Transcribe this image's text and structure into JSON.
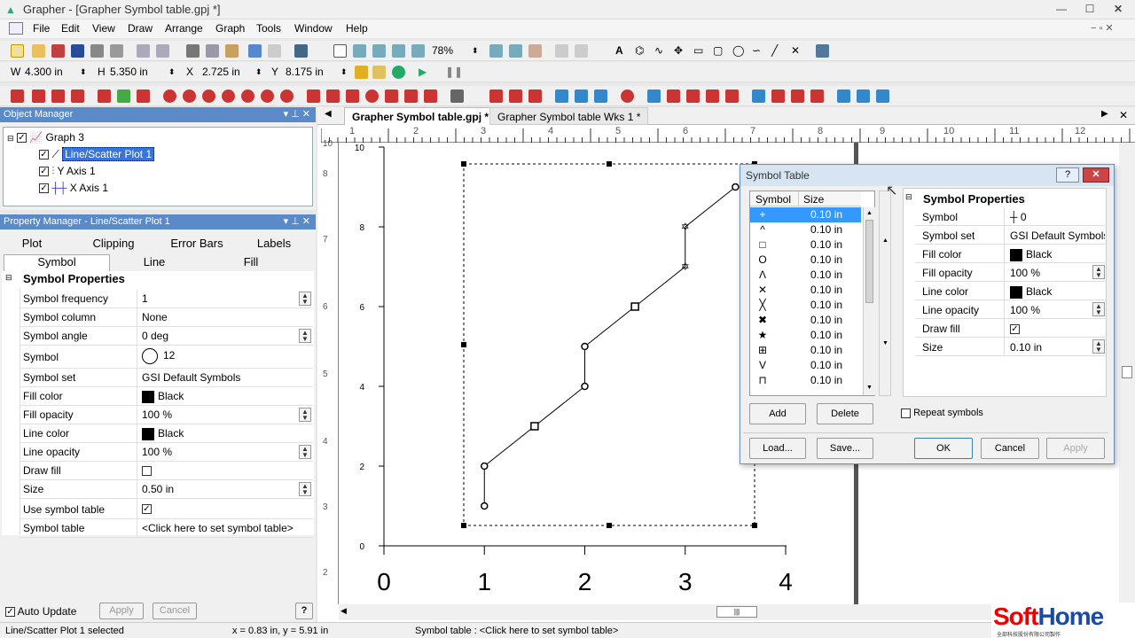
{
  "app": {
    "window_title": "Grapher - [Grapher Symbol table.gpj *]"
  },
  "menu": [
    "File",
    "Edit",
    "View",
    "Draw",
    "Arrange",
    "Graph",
    "Tools",
    "Window",
    "Help"
  ],
  "toolbar": {
    "zoom": "78%",
    "w_label": "W",
    "w_value": "4.300 in",
    "h_label": "H",
    "h_value": "5.350 in",
    "x_label": "X",
    "x_value": "2.725 in",
    "y_label": "Y",
    "y_value": "8.175 in"
  },
  "object_manager": {
    "title": "Object Manager",
    "items": [
      "Graph 3",
      "Line/Scatter Plot 1",
      "Y Axis 1",
      "X Axis 1"
    ]
  },
  "property_manager": {
    "title": "Property Manager - Line/Scatter Plot 1",
    "tabs_row1": [
      "Plot",
      "Clipping",
      "Error Bars",
      "Labels"
    ],
    "tabs_row2": [
      "Symbol",
      "Line",
      "Fill"
    ],
    "section": "Symbol Properties",
    "rows": [
      {
        "k": "Symbol frequency",
        "v": "1"
      },
      {
        "k": "Symbol column",
        "v": "None"
      },
      {
        "k": "Symbol angle",
        "v": "0 deg"
      },
      {
        "k": "Symbol",
        "v": "12"
      },
      {
        "k": "Symbol set",
        "v": "GSI Default Symbols"
      },
      {
        "k": "Fill color",
        "v": "Black"
      },
      {
        "k": "Fill opacity",
        "v": "100 %"
      },
      {
        "k": "Line color",
        "v": "Black"
      },
      {
        "k": "Line opacity",
        "v": "100 %"
      },
      {
        "k": "Draw fill",
        "v": ""
      },
      {
        "k": "Size",
        "v": "0.50 in"
      },
      {
        "k": "Use symbol table",
        "v": ""
      },
      {
        "k": "Symbol table",
        "v": "<Click here to set symbol table>"
      }
    ],
    "auto_update": "Auto Update",
    "apply": "Apply",
    "cancel": "Cancel",
    "help": "?"
  },
  "doc_tabs": [
    "Grapher Symbol table.gpj *",
    "Grapher Symbol table Wks 1 *"
  ],
  "ruler": {
    "top": [
      "1",
      "2",
      "3",
      "4",
      "5",
      "6",
      "7",
      "8",
      "9",
      "10",
      "11",
      "12"
    ],
    "left": [
      "10",
      "8",
      "7",
      "6",
      "5",
      "4",
      "3",
      "2"
    ]
  },
  "chart_data": {
    "type": "line",
    "x": [
      1,
      1,
      1.5,
      2,
      2,
      2.5,
      3,
      3,
      3.5
    ],
    "y": [
      1,
      2,
      3,
      4,
      5,
      6,
      7,
      8,
      9
    ],
    "xlim": [
      0,
      4
    ],
    "ylim": [
      0,
      10
    ],
    "x_ticks": [
      "0",
      "1",
      "2",
      "3",
      "4"
    ],
    "y_ticks": [
      "0",
      "2",
      "4",
      "6",
      "8",
      "10"
    ]
  },
  "dialog": {
    "title": "Symbol Table",
    "col_symbol": "Symbol",
    "col_size": "Size",
    "symbols": [
      {
        "glyph": "+",
        "size": "0.10 in"
      },
      {
        "glyph": "^",
        "size": "0.10 in"
      },
      {
        "glyph": "□",
        "size": "0.10 in"
      },
      {
        "glyph": "O",
        "size": "0.10 in"
      },
      {
        "glyph": "Λ",
        "size": "0.10 in"
      },
      {
        "glyph": "✕",
        "size": "0.10 in"
      },
      {
        "glyph": "╳",
        "size": "0.10 in"
      },
      {
        "glyph": "✖",
        "size": "0.10 in"
      },
      {
        "glyph": "★",
        "size": "0.10 in"
      },
      {
        "glyph": "⊞",
        "size": "0.10 in"
      },
      {
        "glyph": "V",
        "size": "0.10 in"
      },
      {
        "glyph": "⊓",
        "size": "0.10 in"
      }
    ],
    "section": "Symbol Properties",
    "props": [
      {
        "k": "Symbol",
        "v": "0"
      },
      {
        "k": "Symbol set",
        "v": "GSI Default Symbols"
      },
      {
        "k": "Fill color",
        "v": "Black"
      },
      {
        "k": "Fill opacity",
        "v": "100 %"
      },
      {
        "k": "Line color",
        "v": "Black"
      },
      {
        "k": "Line opacity",
        "v": "100 %"
      },
      {
        "k": "Draw fill",
        "v": ""
      },
      {
        "k": "Size",
        "v": "0.10 in"
      }
    ],
    "add": "Add",
    "delete": "Delete",
    "repeat": "Repeat symbols",
    "load": "Load...",
    "save": "Save...",
    "ok": "OK",
    "cancel": "Cancel",
    "apply": "Apply"
  },
  "status": {
    "left": "Line/Scatter Plot 1 selected",
    "coords": "x = 0.83 in, y = 5.91 in",
    "hint": "Symbol table : <Click here to set symbol table>"
  },
  "watermark": {
    "line1": "SoftHome",
    "line2": "全部科技股份有限公司製作"
  }
}
